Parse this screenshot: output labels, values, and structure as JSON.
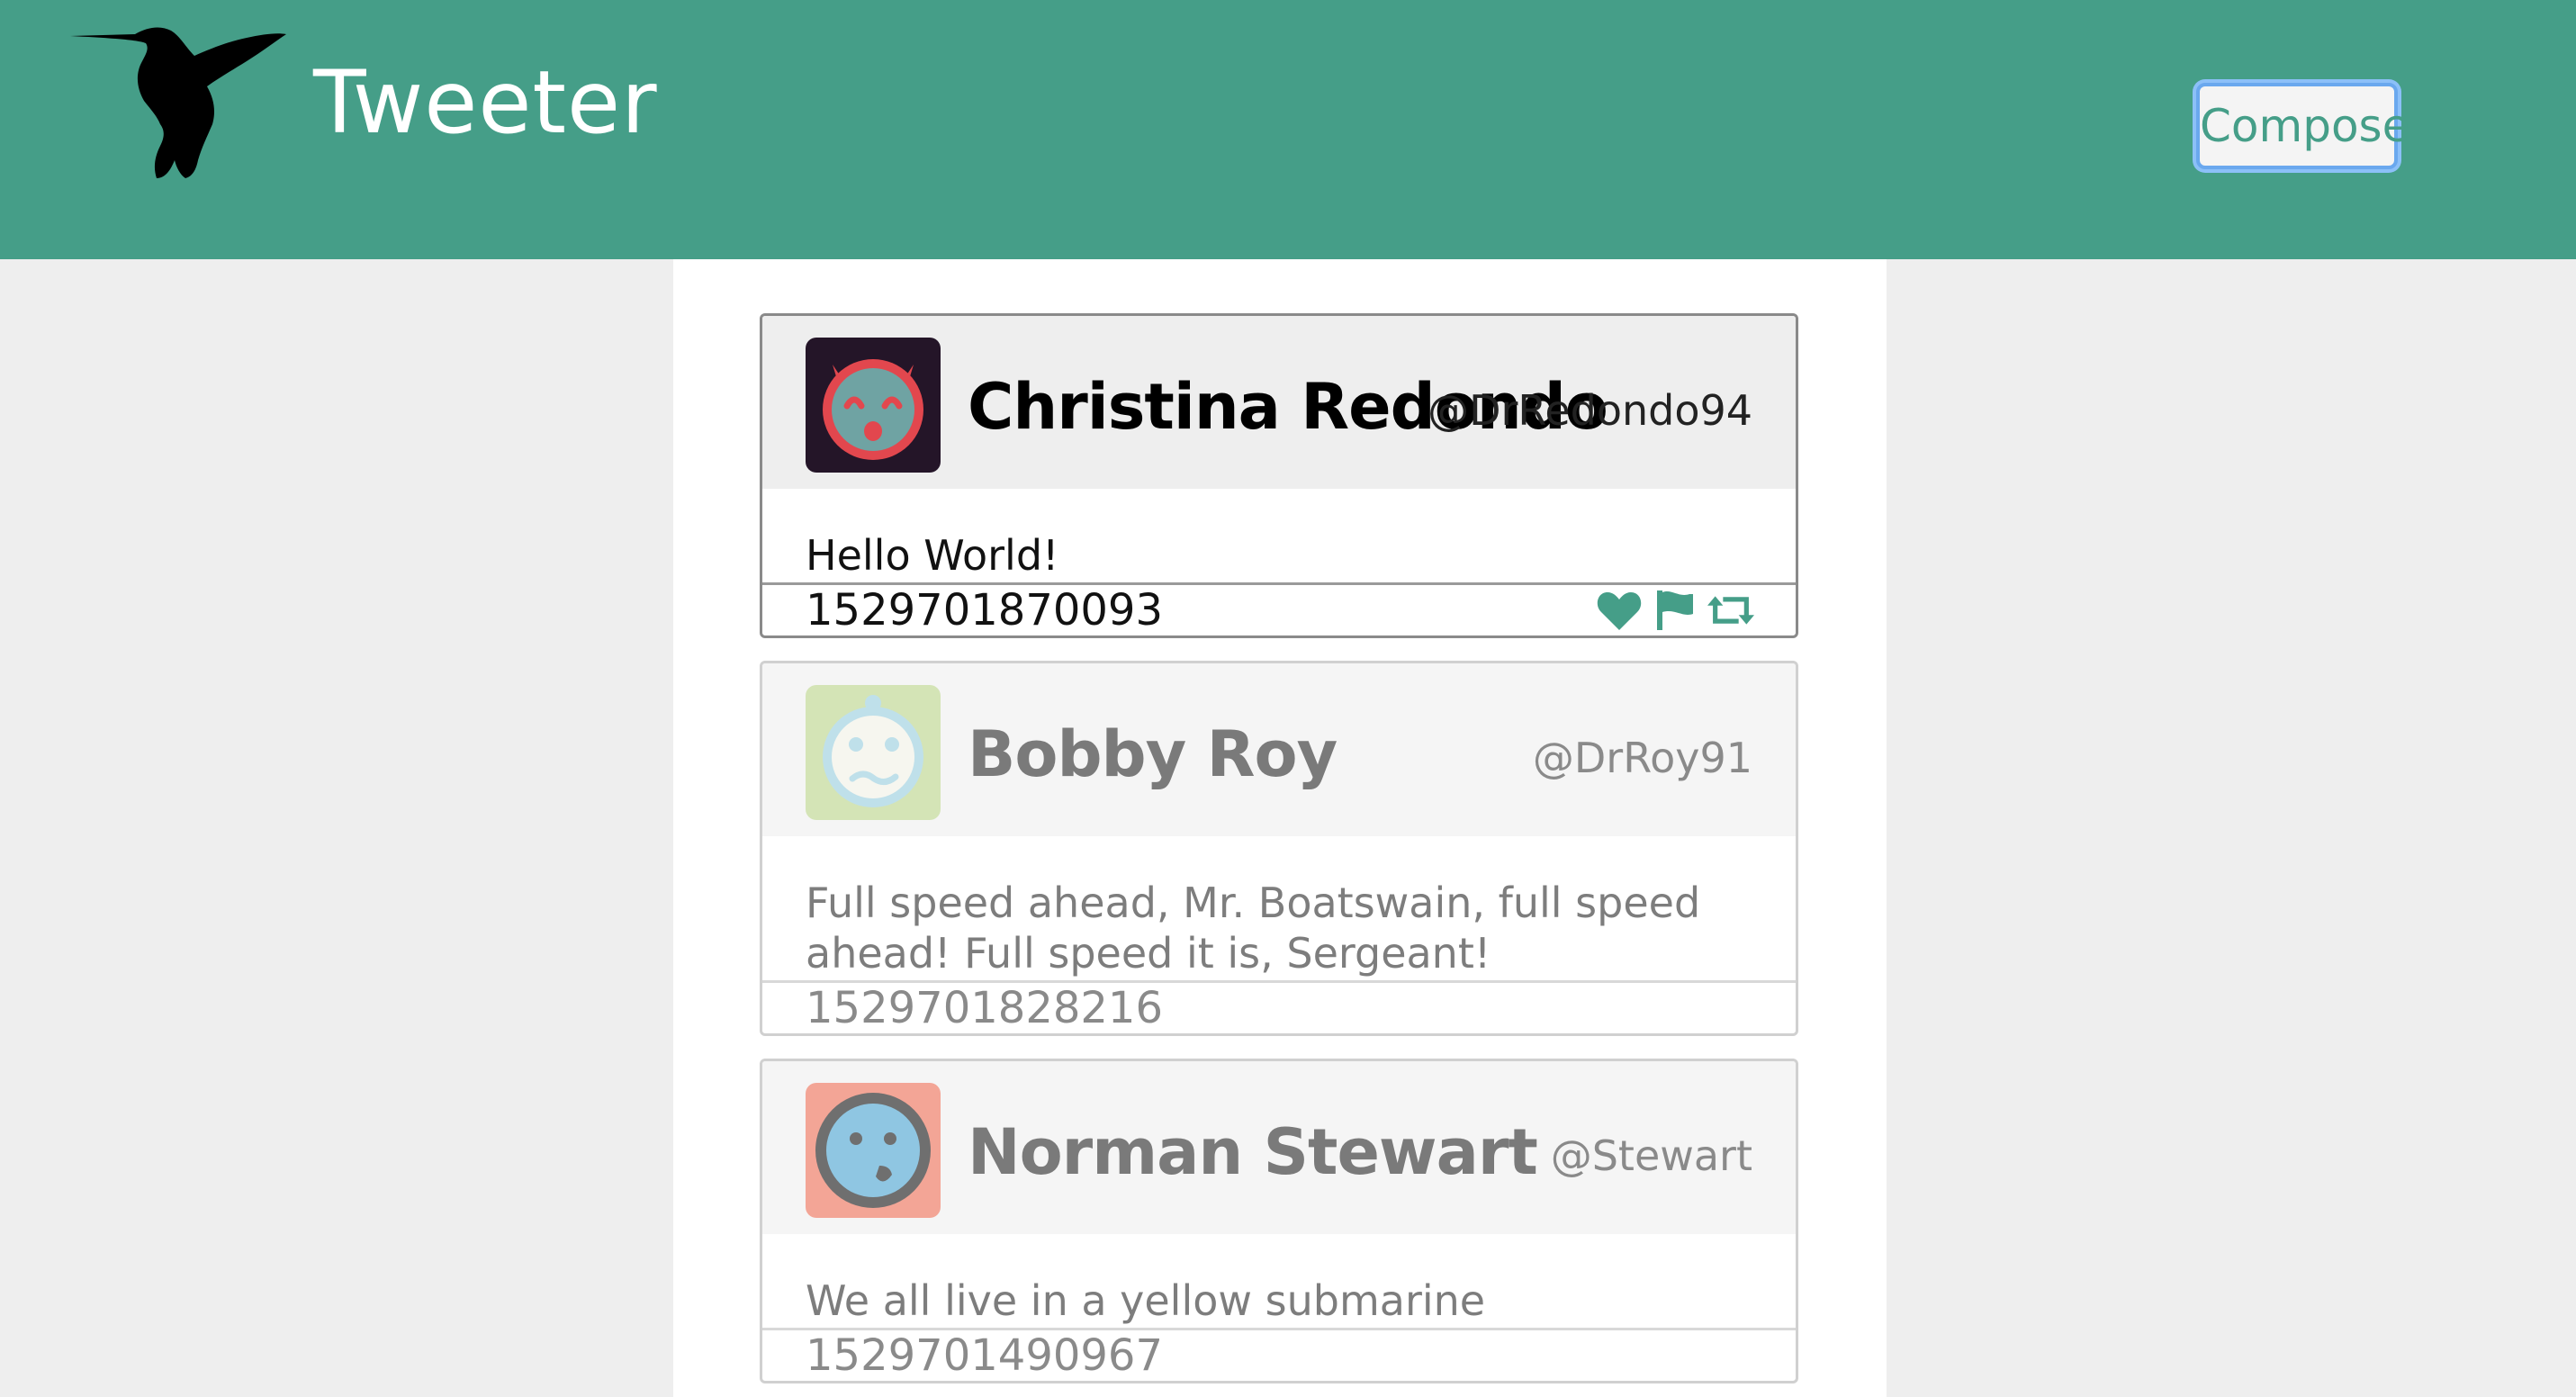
{
  "header": {
    "brand": "Tweeter",
    "logo_icon": "hummingbird-icon",
    "compose_label": "Compose"
  },
  "colors": {
    "brand_green": "#459e88",
    "page_gray": "#eeeeee"
  },
  "tweets": [
    {
      "name": "Christina Redondo",
      "handle": "@DrRedondo94",
      "text": "Hello World!",
      "timestamp": "1529701870093",
      "avatar_icon": "devil-face-avatar-icon",
      "actions": [
        "heart-icon",
        "flag-icon",
        "retweet-icon"
      ]
    },
    {
      "name": "Bobby Roy",
      "handle": "@DrRoy91",
      "text": "Full speed ahead, Mr. Boatswain, full speed ahead! Full speed it is, Sergeant!",
      "timestamp": "1529701828216",
      "avatar_icon": "worried-baby-face-avatar-icon"
    },
    {
      "name": "Norman Stewart",
      "handle": "@Stewart",
      "text": "We all live in a yellow submarine",
      "timestamp": "1529701490967",
      "avatar_icon": "winking-face-avatar-icon"
    }
  ]
}
